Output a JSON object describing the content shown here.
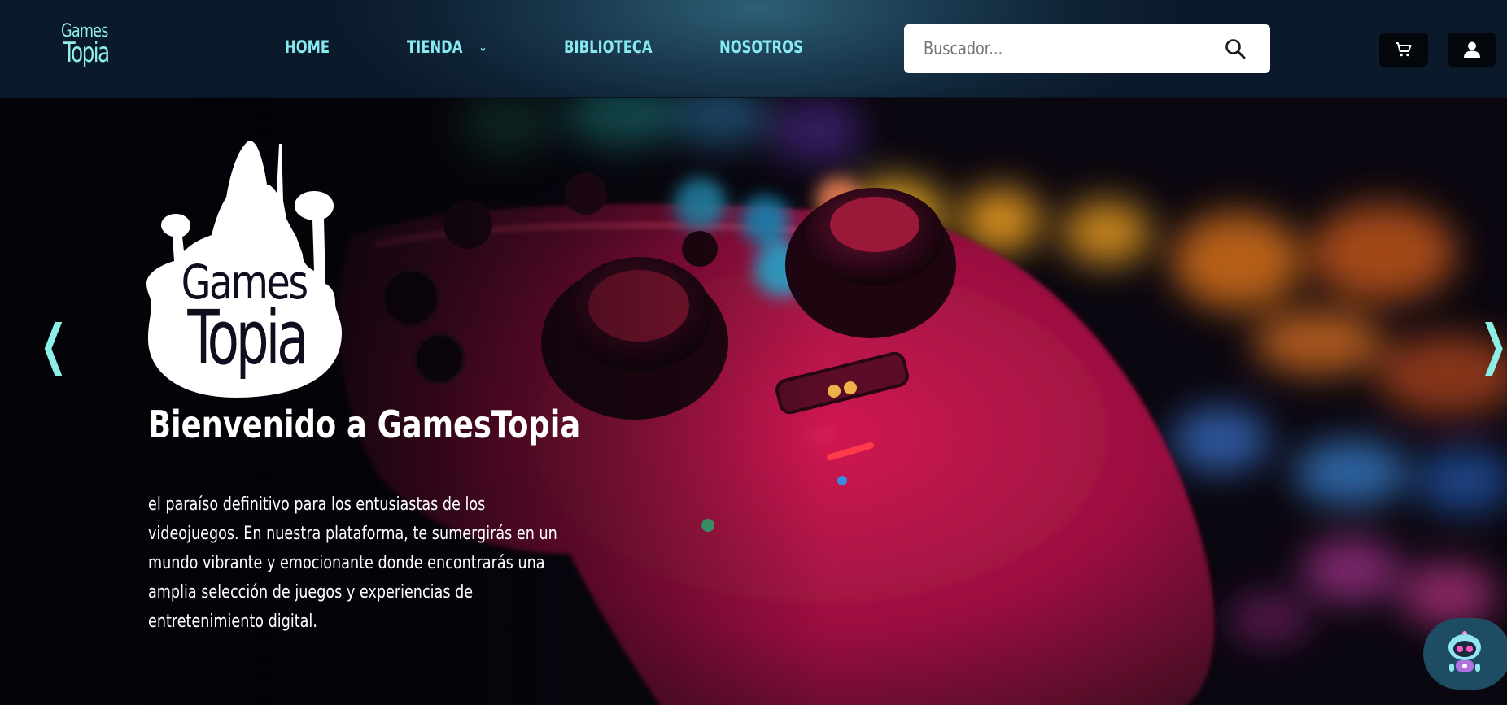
{
  "brand": {
    "logo_line1": "Games",
    "logo_line2": "Topia"
  },
  "nav": {
    "items": [
      {
        "label": "HOME"
      },
      {
        "label": "TIENDA",
        "has_dropdown": true
      },
      {
        "label": "BIBLIOTECA"
      },
      {
        "label": "NOSOTROS"
      }
    ]
  },
  "search": {
    "placeholder": "Buscador..."
  },
  "actions": {
    "cart_icon": "cart-icon",
    "account_icon": "user-icon"
  },
  "hero": {
    "logo_line1": "Games",
    "logo_line2": "Topia",
    "title": "Bienvenido a GamesTopia",
    "description": "el paraíso definitivo para los entusiastas de los videojuegos. En nuestra plataforma, te sumergirás en un mundo vibrante y emocionante donde encontrarás una amplia selección de juegos y experiencias de entretenimiento digital.",
    "prev_arrow": "❮",
    "next_arrow": "❯"
  },
  "colors": {
    "accent": "#86eaf0",
    "header_bg": "#0f2336",
    "controller": "#c0154a"
  },
  "chat": {
    "icon": "robot-icon"
  }
}
